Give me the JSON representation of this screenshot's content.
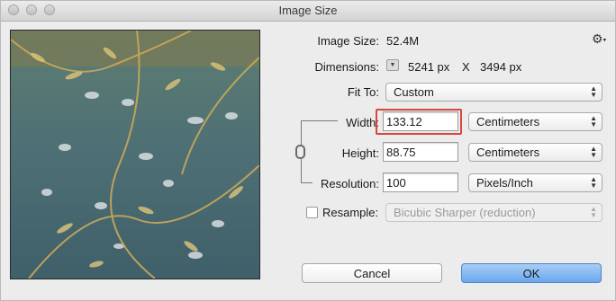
{
  "window": {
    "title": "Image Size"
  },
  "info": {
    "image_size_label": "Image Size:",
    "image_size_value": "52.4M",
    "dimensions_label": "Dimensions:",
    "dimensions_width": "5241 px",
    "dimensions_x": "X",
    "dimensions_height": "3494 px"
  },
  "fit_to": {
    "label": "Fit To:",
    "value": "Custom"
  },
  "width": {
    "label": "Width:",
    "value": "133.12",
    "unit": "Centimeters"
  },
  "height": {
    "label": "Height:",
    "value": "88.75",
    "unit": "Centimeters"
  },
  "resolution": {
    "label": "Resolution:",
    "value": "100",
    "unit": "Pixels/Inch"
  },
  "resample": {
    "label": "Resample:",
    "checked": false,
    "method": "Bicubic Sharper (reduction)"
  },
  "buttons": {
    "cancel": "Cancel",
    "ok": "OK"
  },
  "colors": {
    "highlight": "#d6463e",
    "ok_button": "#6aa8ee"
  },
  "icons": {
    "settings": "gear-icon",
    "link": "chain-link-icon",
    "dimensions_toggle": "chevron-down-icon"
  }
}
